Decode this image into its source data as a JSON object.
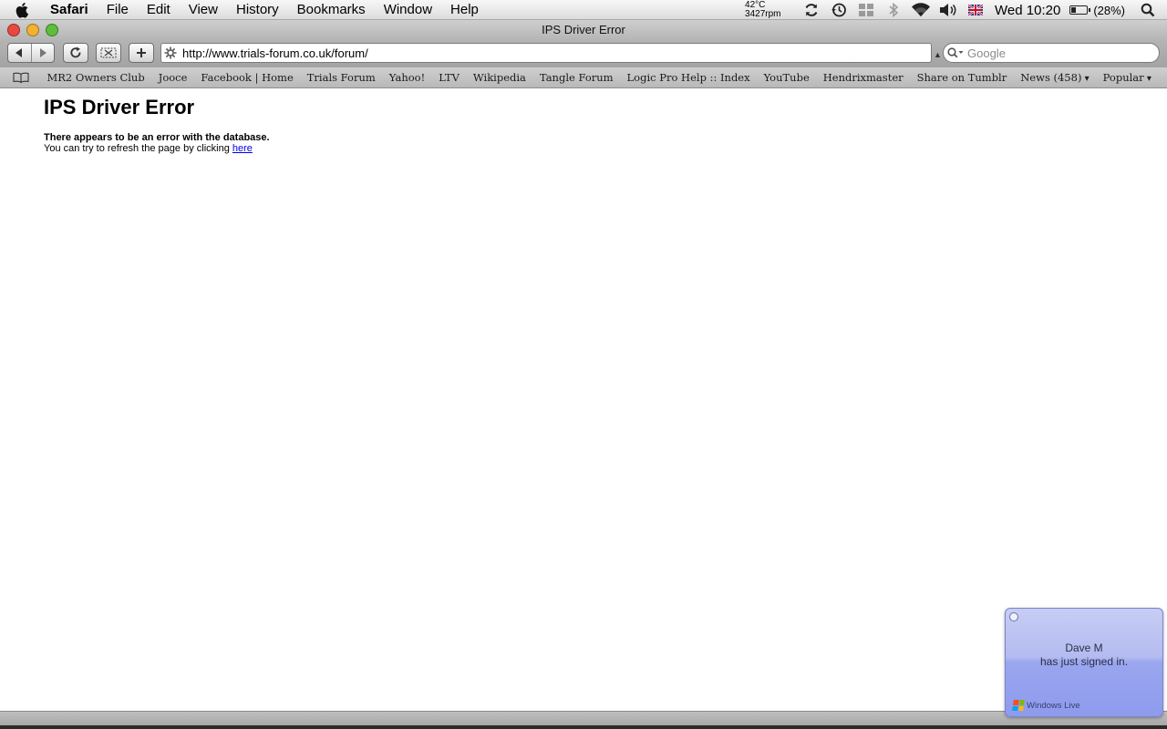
{
  "menubar": {
    "app_name": "Safari",
    "menus": [
      "File",
      "Edit",
      "View",
      "History",
      "Bookmarks",
      "Window",
      "Help"
    ],
    "temperature": "42°C",
    "fan_speed": "3427rpm",
    "clock": "Wed 10:20",
    "battery_label": "(28%)",
    "battery_level": 0.28
  },
  "window": {
    "title": "IPS Driver Error",
    "traffic_colors": {
      "close": "#e8493f",
      "minimize": "#f2b230",
      "zoom": "#5cbf3a"
    }
  },
  "toolbar": {
    "url": "http://www.trials-forum.co.uk/forum/",
    "search_placeholder": "Google"
  },
  "bookmarks": [
    {
      "label": "MR2 Owners Club",
      "dropdown": false
    },
    {
      "label": "Jooce",
      "dropdown": false
    },
    {
      "label": "Facebook | Home",
      "dropdown": false
    },
    {
      "label": "Trials Forum",
      "dropdown": false
    },
    {
      "label": "Yahoo!",
      "dropdown": false
    },
    {
      "label": "LTV",
      "dropdown": false
    },
    {
      "label": "Wikipedia",
      "dropdown": false
    },
    {
      "label": "Tangle Forum",
      "dropdown": false
    },
    {
      "label": "Logic Pro Help :: Index",
      "dropdown": false
    },
    {
      "label": "YouTube",
      "dropdown": false
    },
    {
      "label": "Hendrixmaster",
      "dropdown": false
    },
    {
      "label": "Share on Tumblr",
      "dropdown": false
    },
    {
      "label": "News (458)",
      "dropdown": true
    },
    {
      "label": "Popular",
      "dropdown": true
    }
  ],
  "page": {
    "heading": "IPS Driver Error",
    "error_bold": "There appears to be an error with the database.",
    "refresh_text": "You can try to refresh the page by clicking ",
    "refresh_link": "here",
    "link_color": "#0000ee"
  },
  "notification": {
    "contact": "Dave M",
    "status": "has just signed in.",
    "brand": "Windows Live"
  },
  "icons": {
    "menubar": [
      "apple-icon",
      "sync-icon",
      "time-machine-icon",
      "spaces-icon",
      "bluetooth-icon",
      "wifi-icon",
      "volume-icon",
      "uk-flag-icon",
      "battery-icon",
      "spotlight-icon"
    ],
    "toolbar": [
      "back-icon",
      "forward-icon",
      "reload-icon",
      "snippet-icon",
      "add-bookmark-icon",
      "loading-gear-icon",
      "search-icon"
    ],
    "bookmarks": [
      "bookmarks-book-icon"
    ]
  }
}
